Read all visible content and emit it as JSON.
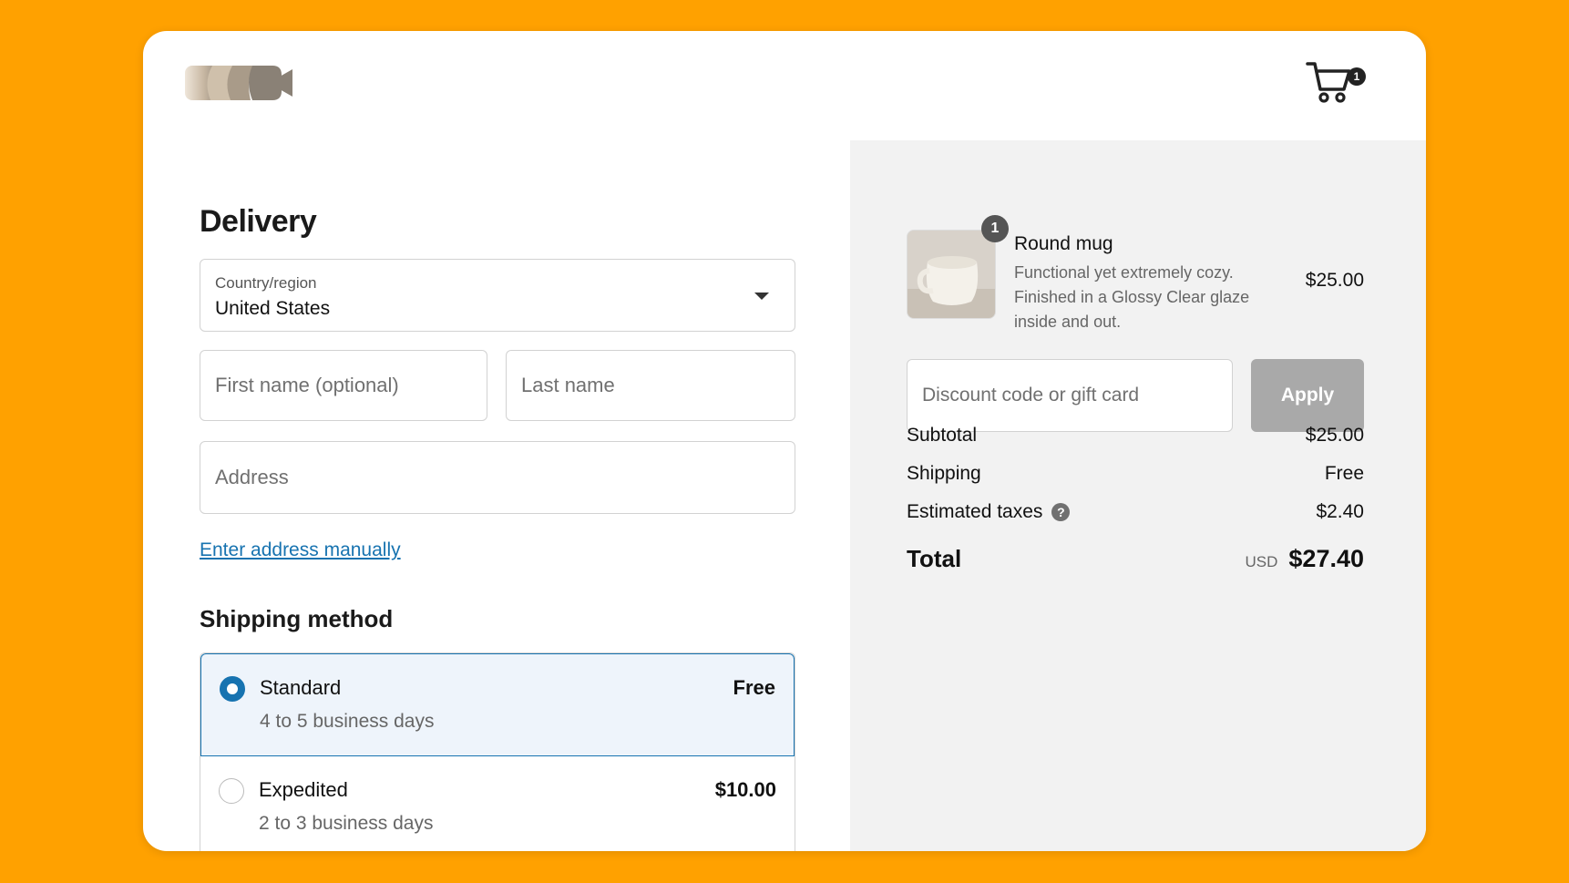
{
  "header": {
    "logo_icon": "brand-logo-icon",
    "cart_icon": "cart-icon",
    "cart_count": "1"
  },
  "delivery": {
    "title": "Delivery",
    "country": {
      "label": "Country/region",
      "value": "United States"
    },
    "first_name": {
      "placeholder": "First name (optional)",
      "value": ""
    },
    "last_name": {
      "placeholder": "Last name",
      "value": ""
    },
    "address": {
      "placeholder": "Address",
      "value": ""
    },
    "manual_link": "Enter address manually"
  },
  "shipping": {
    "title": "Shipping method",
    "options": [
      {
        "name": "Standard",
        "eta": "4 to 5 business days",
        "price": "Free",
        "selected": true
      },
      {
        "name": "Expedited",
        "eta": "2 to 3 business days",
        "price": "$10.00",
        "selected": false
      }
    ]
  },
  "summary": {
    "product": {
      "quantity": "1",
      "name": "Round mug",
      "description": "Functional yet extremely cozy. Finished in a Glossy Clear glaze inside and out.",
      "price": "$25.00"
    },
    "discount": {
      "placeholder": "Discount code or gift card",
      "value": "",
      "apply_label": "Apply"
    },
    "subtotal": {
      "label": "Subtotal",
      "value": "$25.00"
    },
    "shipping": {
      "label": "Shipping",
      "value": "Free"
    },
    "taxes": {
      "label": "Estimated taxes",
      "help": "?",
      "value": "$2.40"
    },
    "total": {
      "label": "Total",
      "currency": "USD",
      "value": "$27.40"
    }
  },
  "colors": {
    "background": "#FFA100",
    "accent": "#1773b0",
    "summary_bg": "#f2f2f2",
    "apply_button": "#a9a9a9"
  }
}
